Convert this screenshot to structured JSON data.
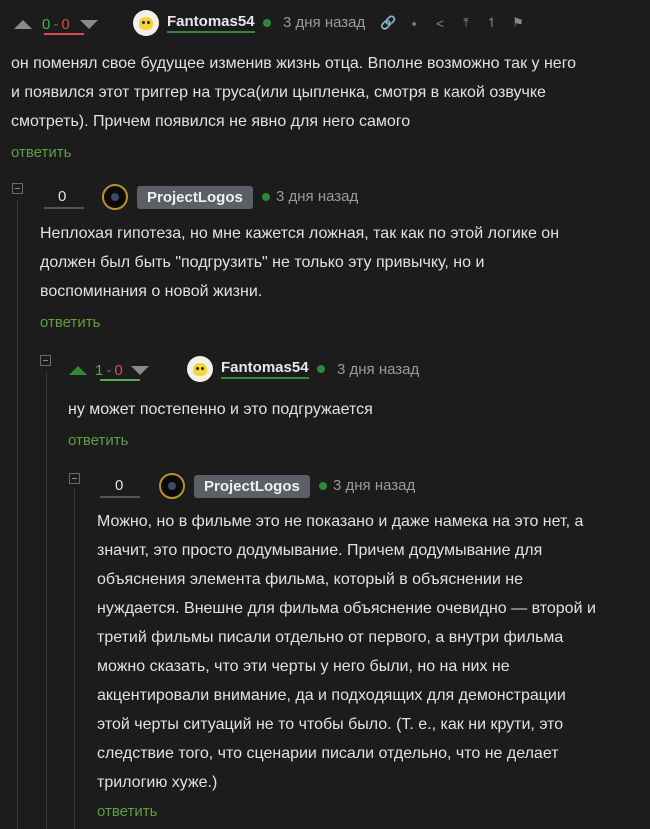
{
  "comments": [
    {
      "rating": {
        "plus": "0",
        "sep": " - ",
        "minus": "0"
      },
      "user": "Fantomas54",
      "date": "3 дня назад",
      "lines": [
        "он поменял свое будущее изменив жизнь отца. Вполне возможно так у него",
        "и появился этот триггер на труса(или цыпленка, смотря в какой озвучке",
        "смотреть). Причем появился не явно для него самого"
      ],
      "reply": "ответить"
    },
    {
      "rating": {
        "value": "0"
      },
      "user": "ProjectLogos",
      "date": "3 дня назад",
      "lines": [
        "Неплохая гипотеза, но мне кажется ложная, так как по этой логике он",
        "должен был быть \"подгрузить\" не только эту привычку, но и",
        "воспоминания о новой жизни."
      ],
      "reply": "ответить"
    },
    {
      "rating": {
        "plus": "1",
        "sep": " - ",
        "minus": "0"
      },
      "user": "Fantomas54",
      "date": "3 дня назад",
      "lines": [
        "ну может постепенно и это подгружается"
      ],
      "reply": "ответить"
    },
    {
      "rating": {
        "value": "0"
      },
      "user": "ProjectLogos",
      "date": "3 дня назад",
      "lines": [
        "Можно, но в фильме это не показано и даже намека на это нет, а",
        "значит, это просто додумывание. Причем додумывание для",
        "объяснения элемента фильма, который в объяснении не",
        "нуждается. Внешне для фильма объяснение очевидно — второй и",
        "третий фильмы писали отдельно от первого, а внутри фильма",
        "можно сказать, что эти черты у него были, но на них не",
        "акцентировали внимание, да и подходящих для демонстрации",
        "этой черты ситуаций не то чтобы было. (Т. е., как ни крути, это",
        "следствие того, что сценарии писали отдельно, что не делает",
        "трилогию хуже.)"
      ],
      "reply": "ответить"
    }
  ],
  "toolbar_icons": [
    "link-icon",
    "save-icon",
    "share-icon",
    "scroll-up-icon",
    "branch-icon",
    "report-flag-icon"
  ]
}
